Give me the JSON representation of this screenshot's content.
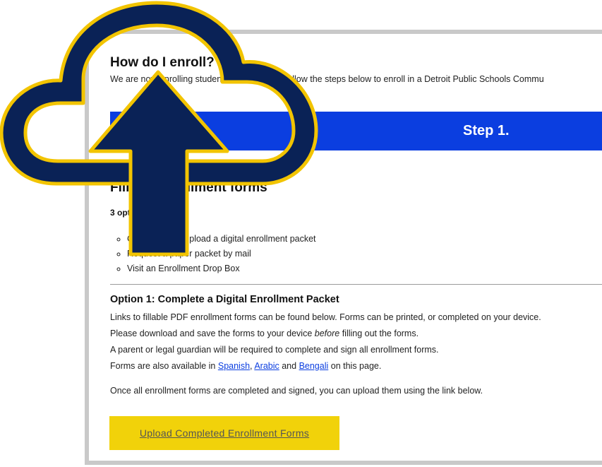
{
  "colors": {
    "banner_blue": "#0b3ee0",
    "button_yellow": "#f1d20a",
    "cloud_navy": "#0a2256",
    "cloud_outline_gold": "#f2c400",
    "panel_border": "#c9c9c9"
  },
  "page": {
    "title": "How do I enroll?",
    "intro": "We are now enrolling students for fall 2020! Follow the steps below to enroll in a Detroit Public Schools Commu",
    "step_label": "Step 1."
  },
  "section": {
    "heading": "Fill out enrollment forms",
    "options_available": "3 options available!",
    "options": [
      "Complete and upload a digital enrollment packet",
      "Request a paper packet by mail",
      "Visit an Enrollment Drop Box"
    ]
  },
  "option1": {
    "heading": "Option 1: Complete a Digital Enrollment Packet",
    "line1": "Links to fillable PDF enrollment forms can be found below. Forms can be printed, or completed on your device.",
    "line2_before": "Please download and save the forms to your device ",
    "line2_emphasis": "before",
    "line2_after": " filling out the forms.",
    "line3": "A parent or legal guardian will be required to complete and sign all enrollment forms.",
    "line4_prefix": "Forms are also available in ",
    "link_spanish": "Spanish",
    "line4_comma": ", ",
    "link_arabic": "Arabic",
    "line4_and": " and ",
    "link_bengali": "Bengali",
    "line4_suffix": " on this page.",
    "line5": "Once all enrollment forms are completed and signed, you can upload them using the link below.",
    "upload_button_label": "Upload Completed Enrollment Forms"
  },
  "overlay": {
    "icon": "cloud-upload-icon"
  }
}
